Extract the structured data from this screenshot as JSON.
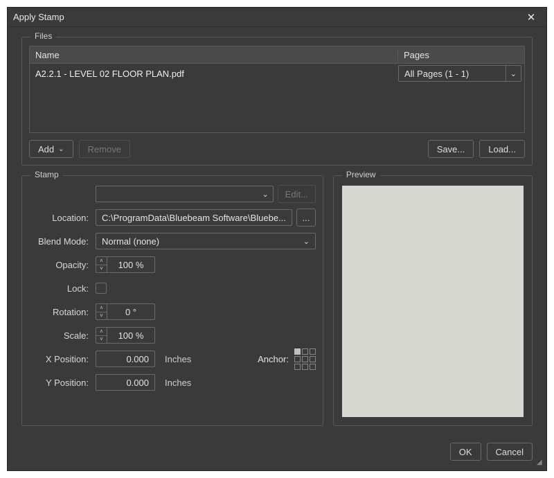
{
  "window": {
    "title": "Apply Stamp"
  },
  "files": {
    "legend": "Files",
    "columns": {
      "name": "Name",
      "pages": "Pages"
    },
    "rows": [
      {
        "name": "A2.2.1 - LEVEL 02 FLOOR PLAN.pdf",
        "pages": "All Pages (1 - 1)"
      }
    ],
    "buttons": {
      "add": "Add",
      "remove": "Remove",
      "save": "Save...",
      "load": "Load..."
    }
  },
  "stamp": {
    "legend": "Stamp",
    "edit": "Edit...",
    "labels": {
      "location": "Location:",
      "blend": "Blend Mode:",
      "opacity": "Opacity:",
      "lock": "Lock:",
      "rotation": "Rotation:",
      "scale": "Scale:",
      "xpos": "X Position:",
      "ypos": "Y Position:",
      "anchor": "Anchor:"
    },
    "values": {
      "stamp_selected": "",
      "location": "C:\\ProgramData\\Bluebeam Software\\Bluebe...",
      "blend_mode": "Normal (none)",
      "opacity": "100 %",
      "rotation": "0 °",
      "scale": "100 %",
      "xpos": "0.000",
      "ypos": "0.000",
      "unit": "Inches",
      "lock": false,
      "anchor_index": 0
    },
    "browse": "..."
  },
  "preview": {
    "legend": "Preview"
  },
  "footer": {
    "ok": "OK",
    "cancel": "Cancel"
  }
}
